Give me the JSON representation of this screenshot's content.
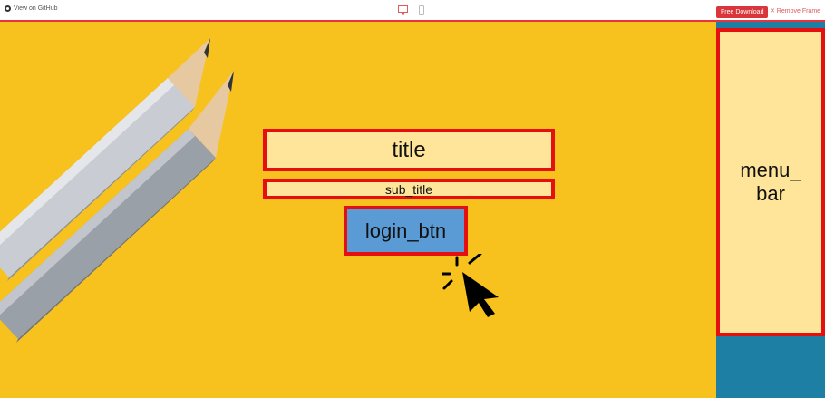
{
  "topbar": {
    "github_link": "View on GitHub",
    "free_download": "Free Download",
    "remove_frame": "✕ Remove Frame",
    "icons": [
      "github-icon",
      "desktop-icon",
      "mobile-icon"
    ]
  },
  "stage": {
    "title": "title",
    "sub_title": "sub_title",
    "login_btn": "login_btn",
    "menu_bar": "menu_\nbar"
  },
  "colors": {
    "background": "#f7c21d",
    "highlight_fill": "#ffe59a",
    "highlight_border": "#e50f0f",
    "button_fill": "#5b9bd5",
    "side_panel": "#1d7fa3",
    "accent": "#d9353b"
  }
}
